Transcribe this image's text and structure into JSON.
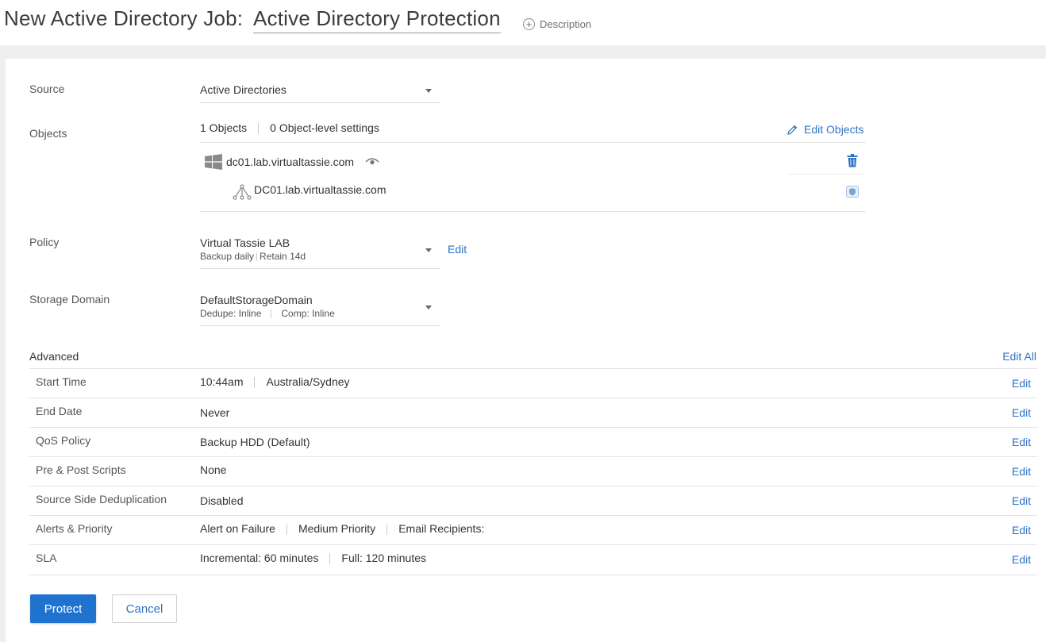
{
  "header": {
    "title_prefix": "New Active Directory Job:",
    "job_name": "Active Directory Protection",
    "description_label": "Description"
  },
  "source": {
    "label": "Source",
    "value": "Active Directories"
  },
  "objects": {
    "label": "Objects",
    "count_text": "1 Objects",
    "settings_text": "0 Object-level settings",
    "edit_label": "Edit Objects",
    "items": [
      {
        "name": "dc01.lab.virtualtassie.com",
        "icon": "windows-icon"
      },
      {
        "name": "DC01.lab.virtualtassie.com",
        "icon": "domain-tree-icon"
      }
    ]
  },
  "policy": {
    "label": "Policy",
    "name": "Virtual Tassie LAB",
    "schedule": "Backup daily",
    "retention": "Retain 14d",
    "edit_label": "Edit"
  },
  "storage": {
    "label": "Storage Domain",
    "name": "DefaultStorageDomain",
    "dedupe": "Dedupe: Inline",
    "comp": "Comp: Inline"
  },
  "advanced": {
    "label": "Advanced",
    "edit_all_label": "Edit All",
    "edit_label": "Edit",
    "rows": [
      {
        "label": "Start Time",
        "values": [
          "10:44am",
          "Australia/Sydney"
        ]
      },
      {
        "label": "End Date",
        "values": [
          "Never"
        ]
      },
      {
        "label": "QoS Policy",
        "values": [
          "Backup HDD (Default)"
        ]
      },
      {
        "label": "Pre & Post Scripts",
        "values": [
          "None"
        ]
      },
      {
        "label": "Source Side Deduplication",
        "values": [
          "Disabled"
        ]
      },
      {
        "label": "Alerts & Priority",
        "values": [
          "Alert on Failure",
          "Medium Priority",
          "Email Recipients:"
        ]
      },
      {
        "label": "SLA",
        "values": [
          "Incremental: 60 minutes",
          "Full: 120 minutes"
        ]
      }
    ]
  },
  "actions": {
    "protect_label": "Protect",
    "cancel_label": "Cancel"
  },
  "colors": {
    "accent": "#2f72c4",
    "primary_button": "#1f73cf",
    "page_bg": "#efefef"
  }
}
